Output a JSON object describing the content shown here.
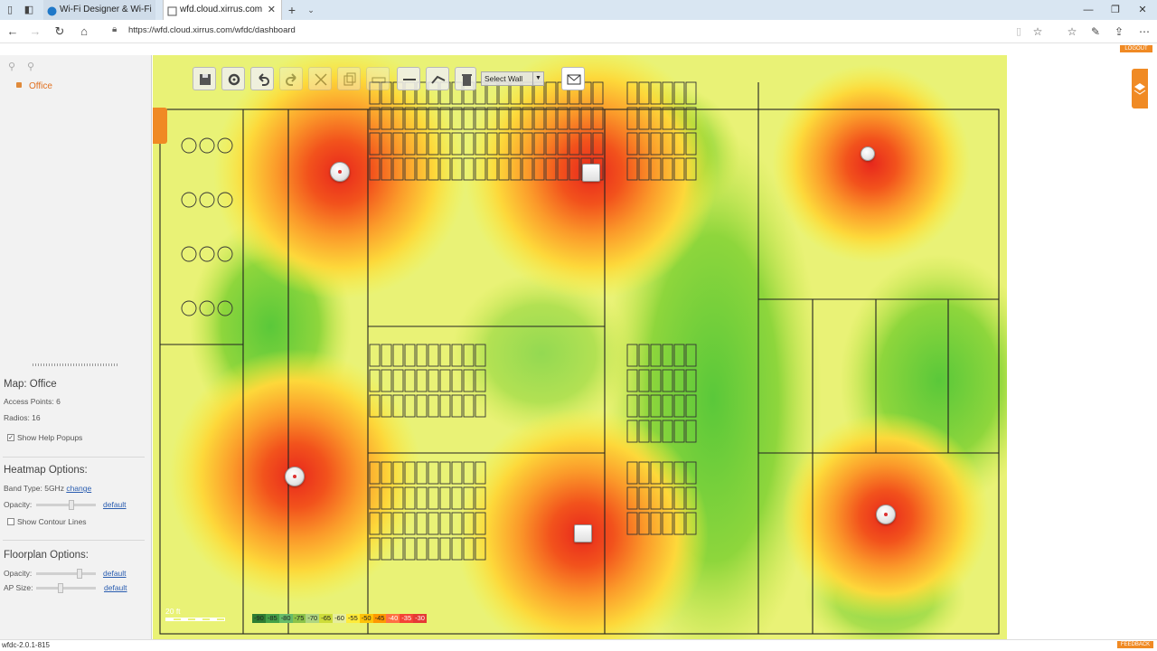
{
  "browser": {
    "tabs": [
      {
        "label": "Wi-Fi Designer & Wi-Fi Insp"
      },
      {
        "label": "wfd.cloud.xirrus.com"
      }
    ],
    "url": "https://wfd.cloud.xirrus.com/wfdc/dashboard"
  },
  "app": {
    "logout_label": "LOGOUT",
    "feedback_label": "FEEDBACK",
    "version": "wfdc-2.0.1-815",
    "tree": {
      "selected": "Office"
    },
    "info": {
      "map": "Map: Office",
      "access_points": "Access Points: 6",
      "radios": "Radios: 16",
      "show_help_popups": "Show Help Popups"
    },
    "heatmap": {
      "title": "Heatmap Options:",
      "band_type": "Band Type: 5GHz",
      "change": "change",
      "opacity": "Opacity:",
      "default": "default",
      "contour": "Show Contour Lines",
      "opacity_level": 0.6
    },
    "floorplan": {
      "title": "Floorplan Options:",
      "opacity": "Opacity:",
      "ap_size": "AP Size:",
      "default": "default",
      "opacity_level": 0.75,
      "ap_size_level": 0.4
    },
    "toolbar": {
      "select_wall": "Select Wall"
    },
    "map": {
      "scale_label": "20 ft",
      "legend": [
        "-90",
        "-85",
        "-80",
        "-75",
        "-70",
        "-65",
        "-60",
        "-55",
        "-50",
        "-45",
        "-40",
        "-35",
        "-30"
      ],
      "legend_colors": [
        "#2e7d32",
        "#43a047",
        "#66bb6a",
        "#8bc34a",
        "#aed581",
        "#cddc39",
        "#e6ee9c",
        "#ffeb3b",
        "#ffc107",
        "#ff9800",
        "#ff7043",
        "#f44336",
        "#e53935"
      ]
    }
  }
}
